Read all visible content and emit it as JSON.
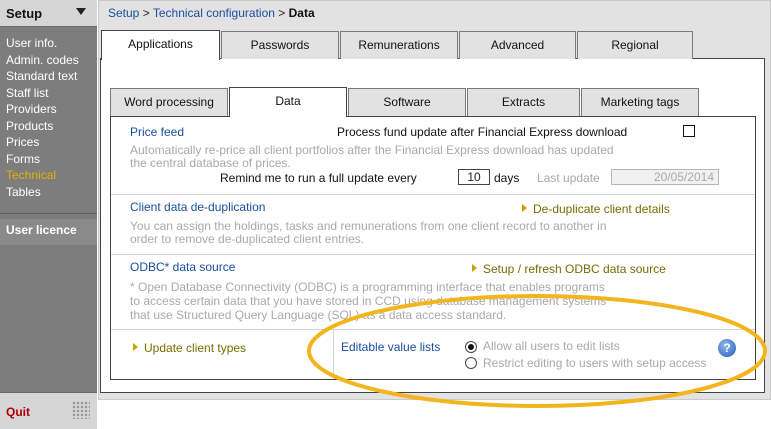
{
  "sidebar": {
    "title": "Setup",
    "items": [
      {
        "label": "User info.",
        "active": false
      },
      {
        "label": "Admin. codes",
        "active": false
      },
      {
        "label": "Standard text",
        "active": false
      },
      {
        "label": "Staff list",
        "active": false
      },
      {
        "label": "Providers",
        "active": false
      },
      {
        "label": "Products",
        "active": false
      },
      {
        "label": "Prices",
        "active": false
      },
      {
        "label": "Forms",
        "active": false
      },
      {
        "label": "Technical",
        "active": true
      },
      {
        "label": "Tables",
        "active": false
      }
    ],
    "user_licence": "User licence",
    "quit": "Quit"
  },
  "breadcrumb": {
    "part1": "Setup",
    "sep1": ">",
    "part2": "Technical configuration",
    "sep2": ">",
    "current": "Data"
  },
  "top_tabs": [
    {
      "label": "Applications",
      "active": true
    },
    {
      "label": "Passwords",
      "active": false
    },
    {
      "label": "Remunerations",
      "active": false
    },
    {
      "label": "Advanced",
      "active": false
    },
    {
      "label": "Regional",
      "active": false
    }
  ],
  "sub_tabs": [
    {
      "label": "Word processing",
      "active": false
    },
    {
      "label": "Data",
      "active": true
    },
    {
      "label": "Software",
      "active": false
    },
    {
      "label": "Extracts",
      "active": false
    },
    {
      "label": "Marketing tags",
      "active": false
    }
  ],
  "price_feed": {
    "title": "Price feed",
    "checkbox_label": "Process fund update after Financial Express download",
    "checkbox_checked": false,
    "description_line1": "Automatically re-price all client portfolios after the Financial Express download has updated",
    "description_line2": "the central database of prices.",
    "remind_label": "Remind me to run a full update every",
    "days_value": "10",
    "days_unit": "days",
    "last_update_label": "Last update",
    "last_update_value": "20/05/2014"
  },
  "dedup": {
    "title": "Client data de-duplication",
    "action": "De-duplicate client details",
    "description_line1": "You can assign the holdings, tasks and remunerations from one client record to another in",
    "description_line2": "order to remove de-duplicated client entries."
  },
  "odbc": {
    "title": "ODBC* data source",
    "action": "Setup / refresh ODBC data source",
    "description_line1": "* Open Database Connectivity (ODBC) is a programming interface that enables programs",
    "description_line2": "to access certain data that you have stored in CCD using database management systems",
    "description_line3": "that use Structured Query Language (SQL) as a data access standard."
  },
  "bottom": {
    "update_types": "Update client types",
    "editable_title": "Editable value lists",
    "option_all": "Allow all users to edit lists",
    "option_restrict": "Restrict editing to users with setup access",
    "selected": "all",
    "help": "?"
  },
  "colors": {
    "accent_link": "#1a4fa0",
    "active_menu": "#e0b400",
    "highlight_ellipse": "#f2b51d",
    "quit": "#b00000"
  }
}
